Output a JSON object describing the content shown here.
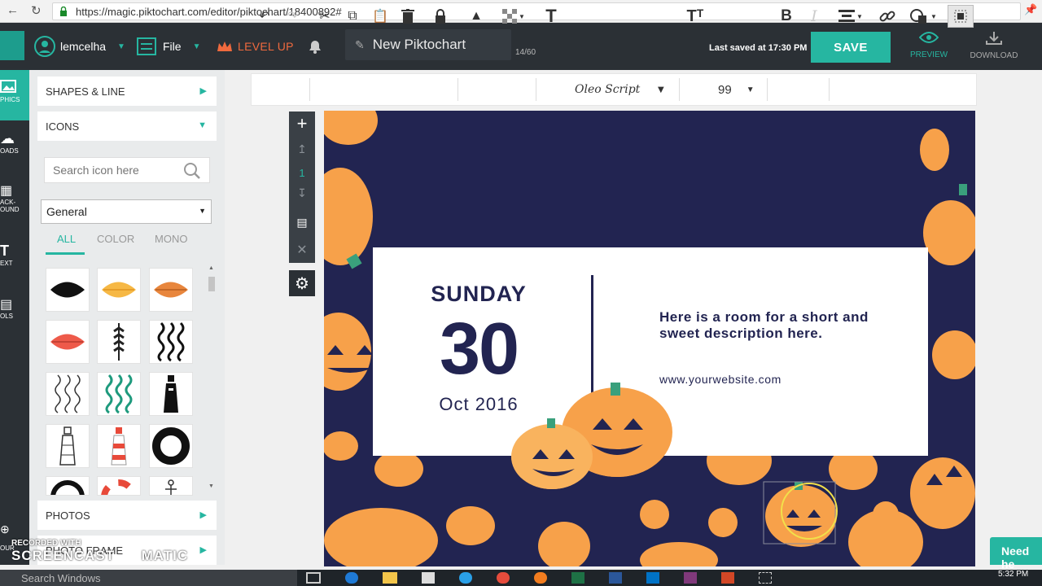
{
  "browser": {
    "url": "https://magic.piktochart.com/editor/piktochart/18400892#",
    "back_icon": "arrow-left-icon",
    "reload_icon": "reload-icon"
  },
  "topbar": {
    "username": "lemcelha",
    "file_label": "File",
    "levelup_label": "LEVEL UP",
    "title": "New Piktochart",
    "char_counter": "14/60",
    "last_saved": "Last saved at 17:30 PM",
    "save_label": "SAVE",
    "preview_label": "PREVIEW",
    "download_label": "DOWNLOAD",
    "accent": "#26b6a1",
    "levelup_color": "#f06a3e"
  },
  "rail": {
    "items": [
      "PHICS",
      "OADS",
      "ACK-\nOUND",
      "EXT",
      "OLS",
      "OUR"
    ]
  },
  "panel": {
    "shapes_label": "SHAPES & LINE",
    "icons_label": "ICONS",
    "search_placeholder": "Search icon here",
    "category": "General",
    "filter_tabs": [
      "ALL",
      "COLOR",
      "MONO"
    ],
    "photos_label": "PHOTOS",
    "photo_frame_label": "PHOTO FRAME"
  },
  "toolbar": {
    "font_name": "Oleo Script",
    "font_size": "99"
  },
  "layer_tools": {
    "layer_number": "1"
  },
  "graphic": {
    "day_name": "SUNDAY",
    "day_number": "30",
    "month_year": "Oct 2016",
    "description": "Here is a room for a  short and sweet description here.",
    "website": "www.yourwebsite.com",
    "background_color": "#222451",
    "pumpkin_color": "#f7a14a"
  },
  "overlays": {
    "recorded_with": "RECORDED WITH",
    "screencast": "SCREENCAST",
    "matic": "MATIC",
    "need_help": "Need he",
    "taskbar_search": "Search Windows",
    "clock_time": "5:32 PM"
  }
}
